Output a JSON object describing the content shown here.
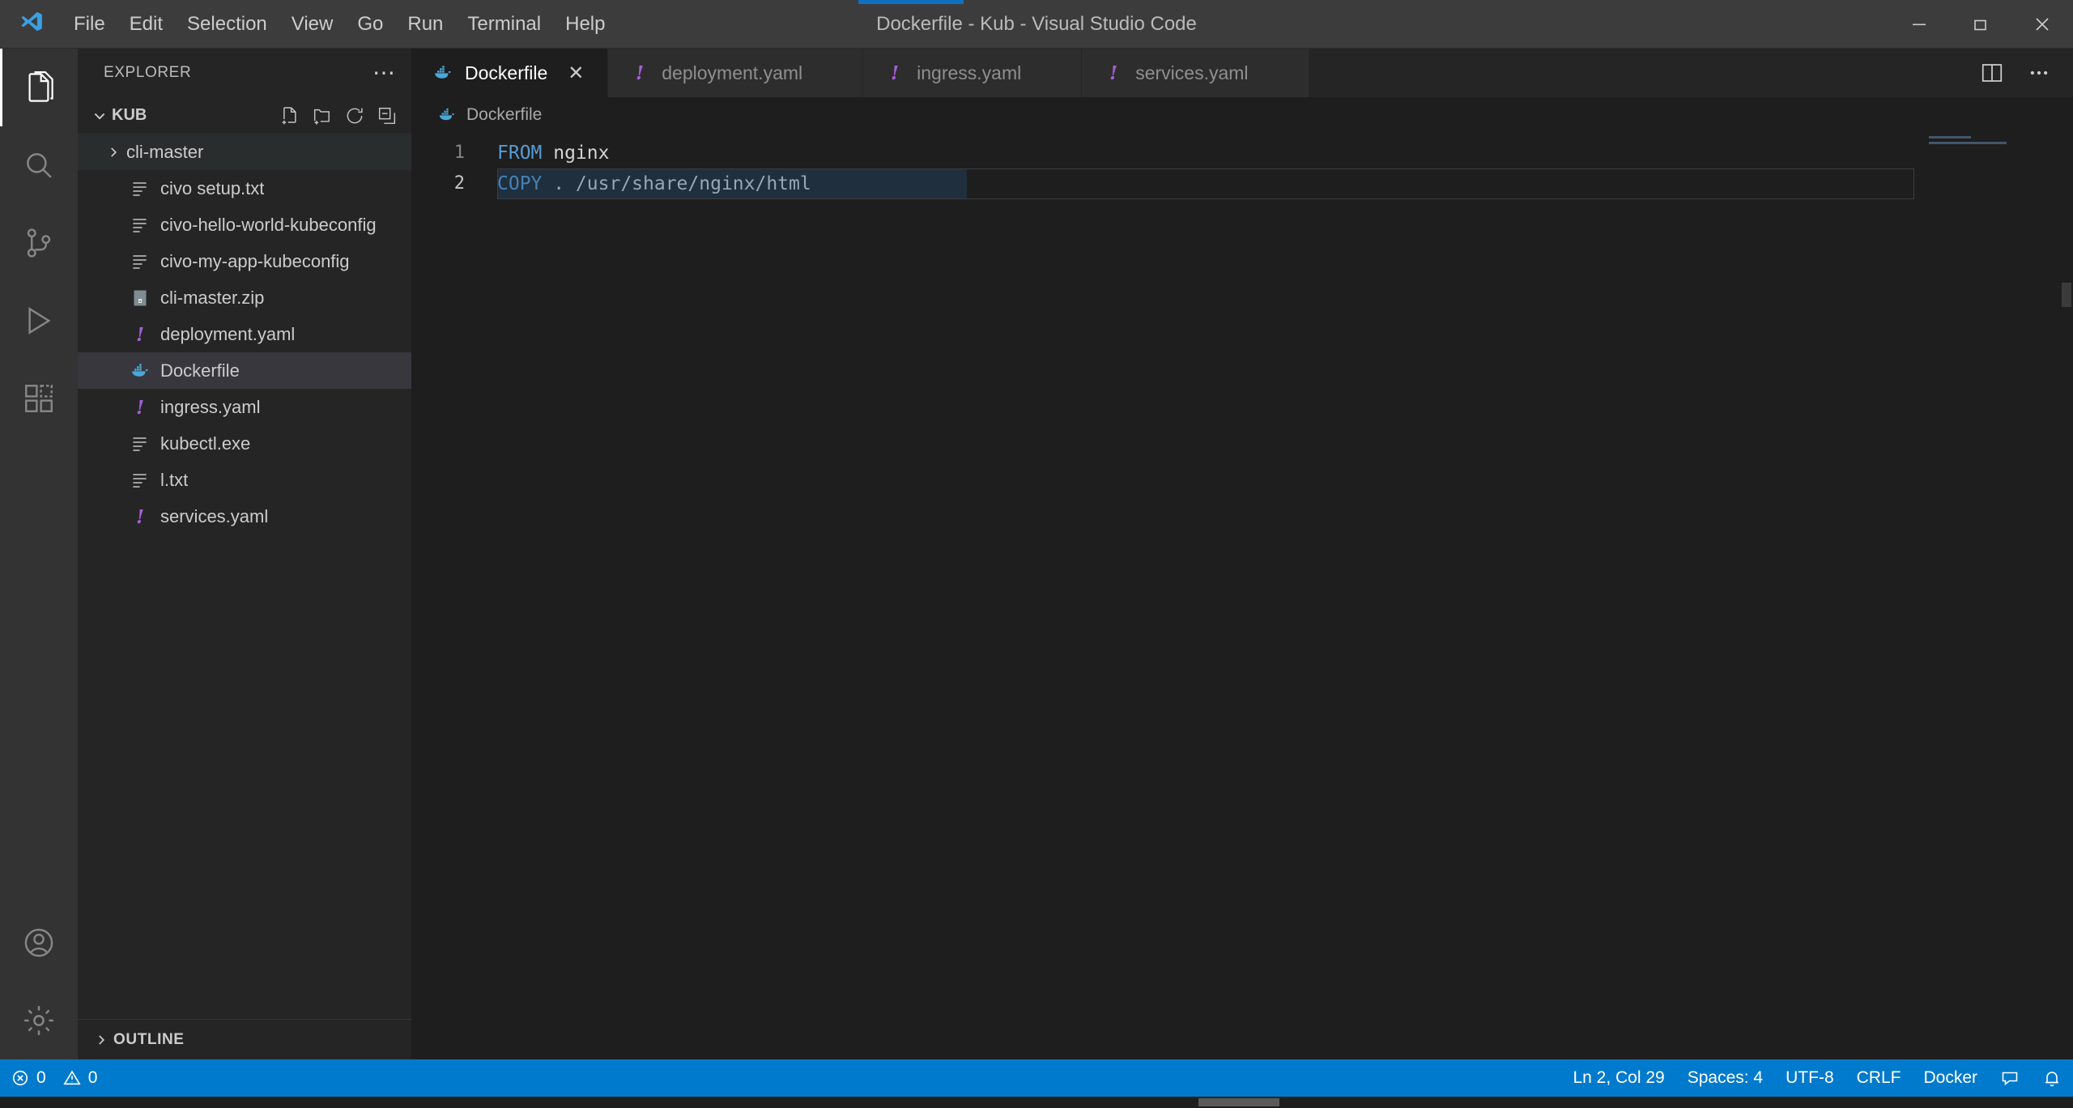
{
  "window": {
    "title": "Dockerfile - Kub - Visual Studio Code",
    "minimize_label": "Minimize",
    "maximize_label": "Restore",
    "close_label": "Close",
    "accent_color": "#0e70c0"
  },
  "menubar": {
    "items": [
      {
        "label": "File"
      },
      {
        "label": "Edit"
      },
      {
        "label": "Selection"
      },
      {
        "label": "View"
      },
      {
        "label": "Go"
      },
      {
        "label": "Run"
      },
      {
        "label": "Terminal"
      },
      {
        "label": "Help"
      }
    ]
  },
  "activitybar": {
    "items": [
      {
        "name": "explorer",
        "icon": "files-icon",
        "active": true
      },
      {
        "name": "search",
        "icon": "search-icon",
        "active": false
      },
      {
        "name": "source-control",
        "icon": "source-control-icon",
        "active": false
      },
      {
        "name": "run-and-debug",
        "icon": "run-debug-icon",
        "active": false
      },
      {
        "name": "extensions",
        "icon": "extensions-icon",
        "active": false
      }
    ],
    "bottom_items": [
      {
        "name": "accounts",
        "icon": "account-icon"
      },
      {
        "name": "manage",
        "icon": "gear-icon"
      }
    ]
  },
  "sidebar": {
    "header_title": "EXPLORER",
    "more_actions_label": "⋯",
    "folder": {
      "name": "KUB",
      "expanded": true,
      "actions": [
        {
          "name": "new-file",
          "icon": "new-file-icon"
        },
        {
          "name": "new-folder",
          "icon": "new-folder-icon"
        },
        {
          "name": "refresh",
          "icon": "refresh-icon"
        },
        {
          "name": "collapse-all",
          "icon": "collapse-all-icon"
        }
      ]
    },
    "files": [
      {
        "label": "cli-master",
        "icon": "chevron-right-icon",
        "type": "folder",
        "state": "hovered"
      },
      {
        "label": "civo setup.txt",
        "icon": "text-file-icon",
        "type": "file",
        "state": "none"
      },
      {
        "label": "civo-hello-world-kubeconfig",
        "icon": "text-file-icon",
        "type": "file",
        "state": "none"
      },
      {
        "label": "civo-my-app-kubeconfig",
        "icon": "text-file-icon",
        "type": "file",
        "state": "none"
      },
      {
        "label": "cli-master.zip",
        "icon": "zip-file-icon",
        "type": "file",
        "state": "none"
      },
      {
        "label": "deployment.yaml",
        "icon": "yaml-file-icon",
        "type": "file",
        "state": "none"
      },
      {
        "label": "Dockerfile",
        "icon": "docker-file-icon",
        "type": "file",
        "state": "selected"
      },
      {
        "label": "ingress.yaml",
        "icon": "yaml-file-icon",
        "type": "file",
        "state": "none"
      },
      {
        "label": "kubectl.exe",
        "icon": "text-file-icon",
        "type": "file",
        "state": "none"
      },
      {
        "label": "l.txt",
        "icon": "text-file-icon",
        "type": "file",
        "state": "none"
      },
      {
        "label": "services.yaml",
        "icon": "yaml-file-icon",
        "type": "file",
        "state": "none"
      }
    ],
    "outline_label": "OUTLINE"
  },
  "editor": {
    "tabs": [
      {
        "label": "Dockerfile",
        "icon": "docker-file-icon",
        "active": true,
        "closable": true
      },
      {
        "label": "deployment.yaml",
        "icon": "yaml-file-icon",
        "active": false,
        "closable": false
      },
      {
        "label": "ingress.yaml",
        "icon": "yaml-file-icon",
        "active": false,
        "closable": false
      },
      {
        "label": "services.yaml",
        "icon": "yaml-file-icon",
        "active": false,
        "closable": false
      }
    ],
    "tab_close_glyph": "✕",
    "actions": [
      {
        "name": "split-editor",
        "icon": "split-editor-icon"
      },
      {
        "name": "more-actions",
        "icon": "ellipsis-icon"
      }
    ],
    "breadcrumb": {
      "label": "Dockerfile",
      "icon": "docker-file-icon"
    },
    "code": {
      "language": "dockerfile",
      "lines": [
        {
          "number": "1",
          "keyword": "FROM",
          "rest": " nginx",
          "selected": false
        },
        {
          "number": "2",
          "keyword": "COPY",
          "rest": " . /usr/share/nginx/html",
          "selected": true
        }
      ]
    }
  },
  "statusbar": {
    "background": "#007acc",
    "left": [
      {
        "name": "problems-errors",
        "icon": "error-icon",
        "label": "0"
      },
      {
        "name": "problems-warnings",
        "icon": "warning-icon",
        "label": "0"
      }
    ],
    "right": [
      {
        "name": "cursor-position",
        "label": "Ln 2, Col 29"
      },
      {
        "name": "indentation",
        "label": "Spaces: 4"
      },
      {
        "name": "encoding",
        "label": "UTF-8"
      },
      {
        "name": "eol",
        "label": "CRLF"
      },
      {
        "name": "language-mode",
        "label": "Docker"
      },
      {
        "name": "feedback",
        "icon": "feedback-icon",
        "label": ""
      },
      {
        "name": "notifications",
        "icon": "bell-icon",
        "label": ""
      }
    ]
  }
}
